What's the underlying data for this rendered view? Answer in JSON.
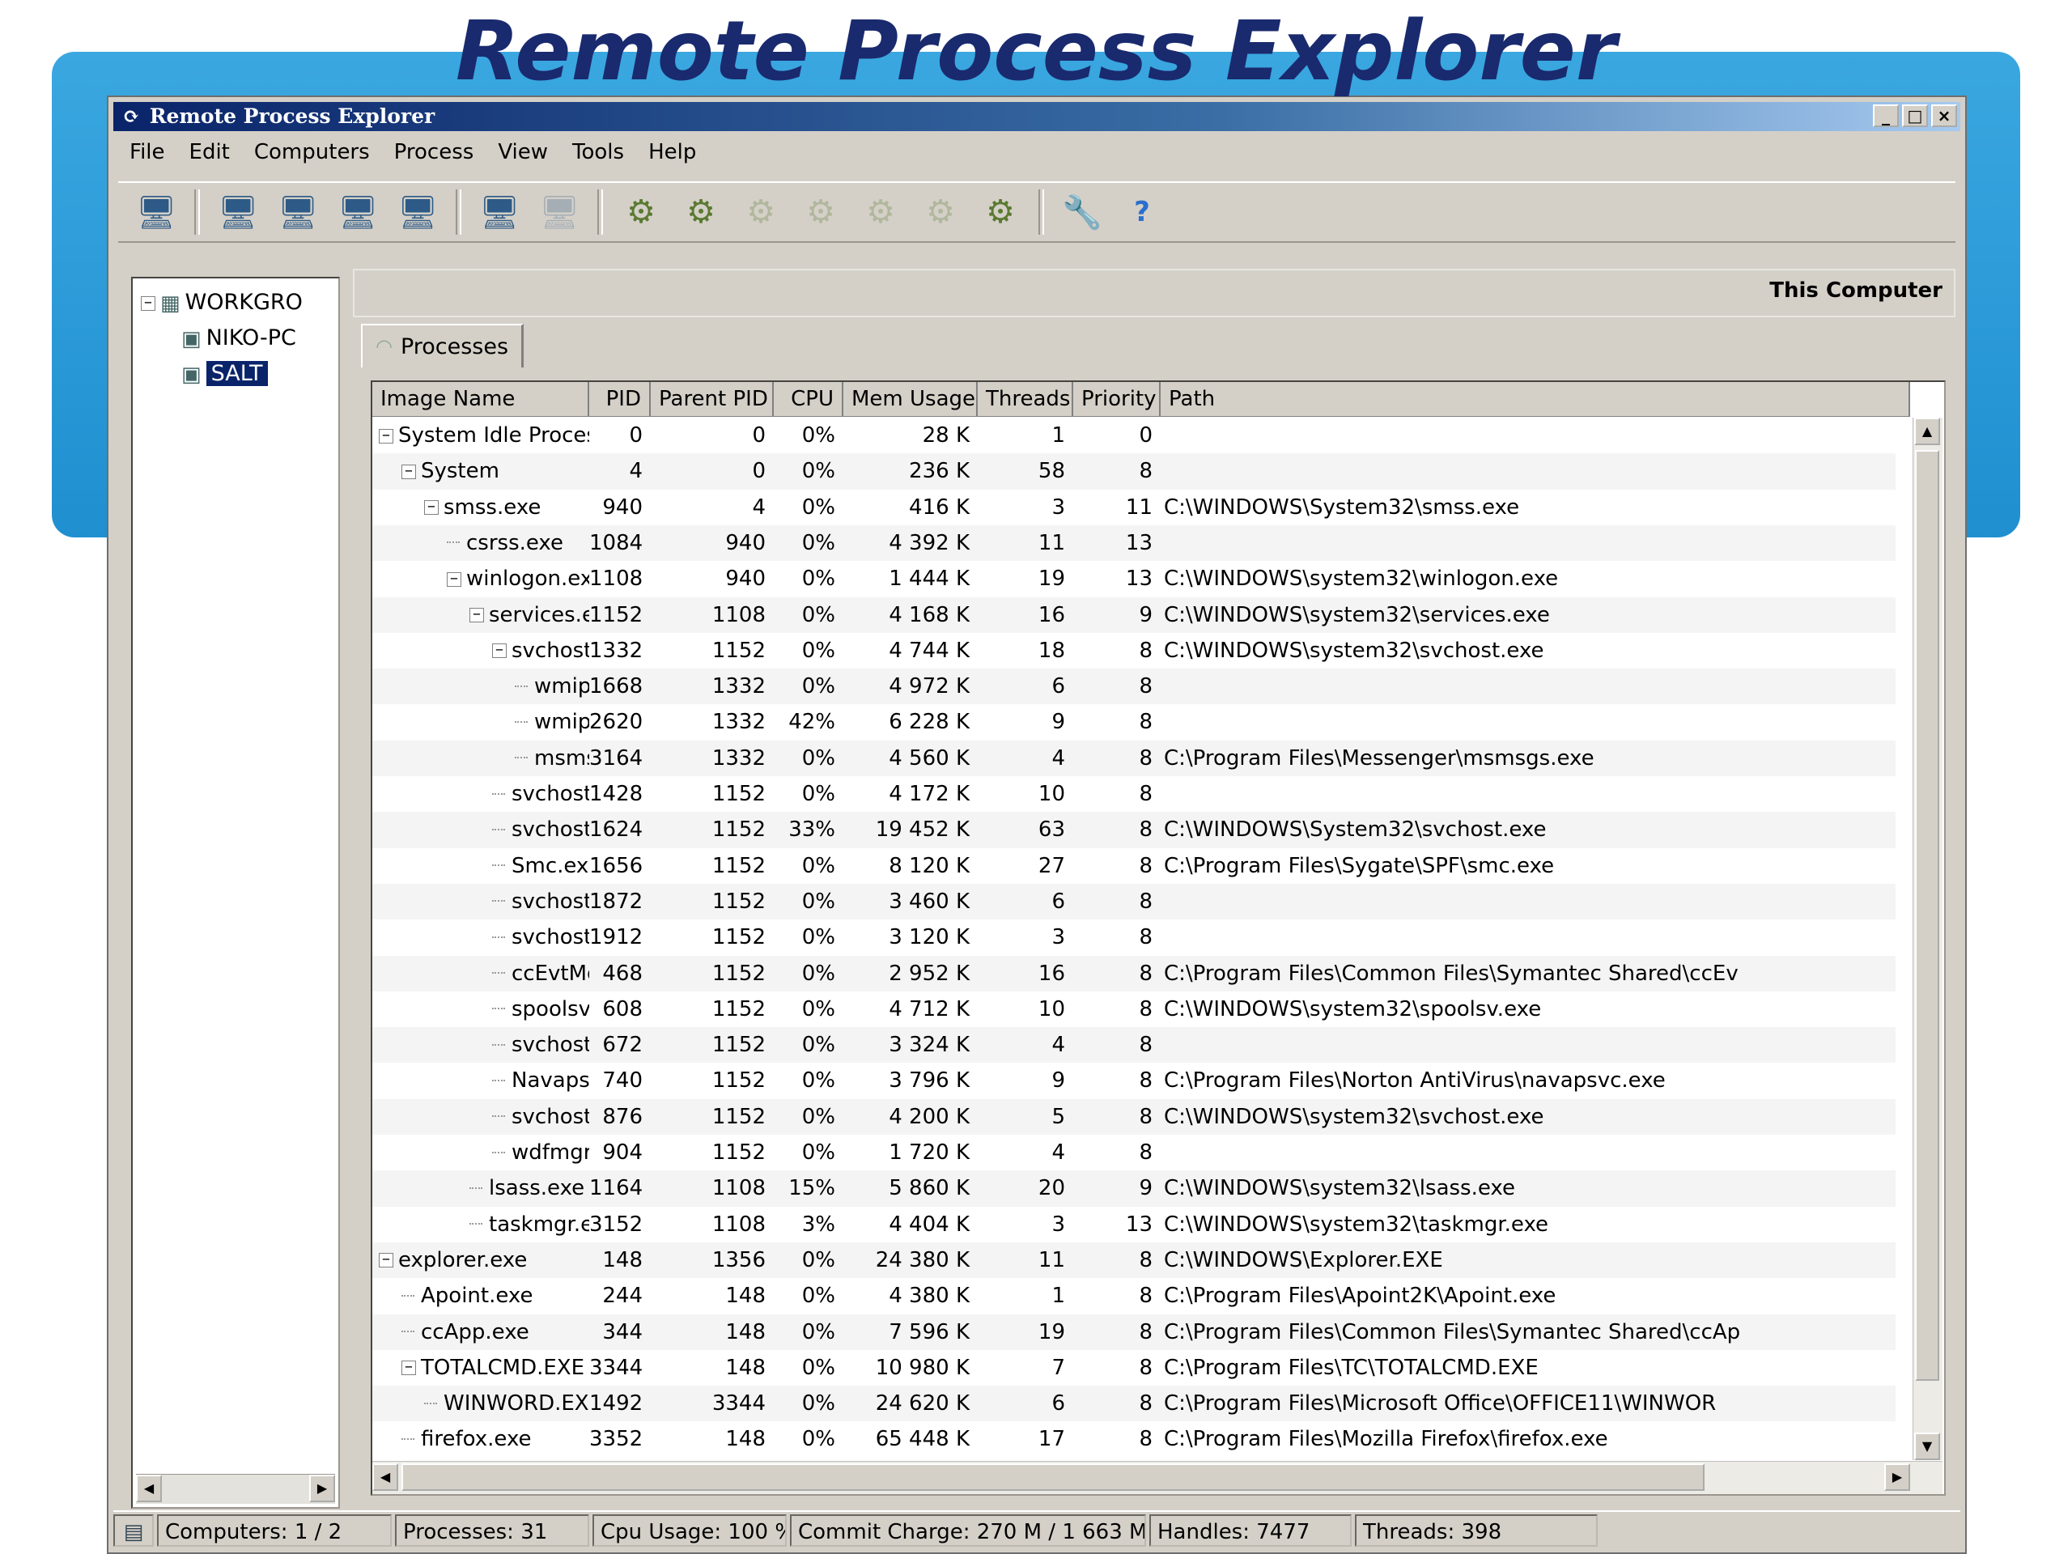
{
  "slide": {
    "title": "Remote Process Explorer"
  },
  "window": {
    "title": "Remote Process Explorer",
    "buttons": [
      "_",
      "□",
      "×"
    ]
  },
  "menu": [
    "File",
    "Edit",
    "Computers",
    "Process",
    "View",
    "Tools",
    "Help"
  ],
  "toolbar": {
    "icons": [
      {
        "name": "find-computer-icon",
        "glyph": "🖥",
        "enabled": true
      },
      {
        "name": "add-computer-icon",
        "glyph": "🖥",
        "enabled": true
      },
      {
        "name": "connect-computer-icon",
        "glyph": "🖥",
        "enabled": true
      },
      {
        "name": "remove-computer-icon",
        "glyph": "🖥",
        "enabled": true
      },
      {
        "name": "computer-properties-icon",
        "glyph": "🖥",
        "enabled": true
      },
      {
        "name": "refresh-computer-icon",
        "glyph": "🖥",
        "enabled": true
      },
      {
        "name": "disconnect-computer-icon",
        "glyph": "🖥",
        "enabled": false
      },
      {
        "name": "run-process-icon",
        "glyph": "⚙",
        "enabled": true
      },
      {
        "name": "process-settings-icon",
        "glyph": "⚙",
        "enabled": true
      },
      {
        "name": "kill-process-icon",
        "glyph": "⚙",
        "enabled": false
      },
      {
        "name": "suspend-process-icon",
        "glyph": "⚙",
        "enabled": false
      },
      {
        "name": "process-priority-icon",
        "glyph": "⚙",
        "enabled": false
      },
      {
        "name": "process-info-icon",
        "glyph": "⚙",
        "enabled": false
      },
      {
        "name": "services-icon",
        "glyph": "⚙",
        "enabled": true
      },
      {
        "name": "tools-icon",
        "glyph": "🔧",
        "enabled": true
      },
      {
        "name": "help-icon",
        "glyph": "?",
        "enabled": true
      }
    ]
  },
  "tree": {
    "root": "WORKGRO",
    "children": [
      "NIKO-PC",
      "SALT"
    ],
    "selected": "SALT"
  },
  "pane": {
    "header": "This Computer",
    "tab": "Processes"
  },
  "columns": [
    "Image Name",
    "PID",
    "Parent PID",
    "CPU",
    "Mem Usage",
    "Threads",
    "Priority",
    "Path"
  ],
  "processes": [
    {
      "name": "System Idle Process",
      "depth": 0,
      "expander": "−",
      "pid": "0",
      "ppid": "0",
      "cpu": "0%",
      "mem": "28 K",
      "threads": "1",
      "priority": "0",
      "path": ""
    },
    {
      "name": "System",
      "depth": 1,
      "expander": "−",
      "pid": "4",
      "ppid": "0",
      "cpu": "0%",
      "mem": "236 K",
      "threads": "58",
      "priority": "8",
      "path": ""
    },
    {
      "name": "smss.exe",
      "depth": 2,
      "expander": "−",
      "pid": "940",
      "ppid": "4",
      "cpu": "0%",
      "mem": "416 K",
      "threads": "3",
      "priority": "11",
      "path": "C:\\WINDOWS\\System32\\smss.exe"
    },
    {
      "name": "csrss.exe",
      "depth": 3,
      "expander": "",
      "pid": "1084",
      "ppid": "940",
      "cpu": "0%",
      "mem": "4 392 K",
      "threads": "11",
      "priority": "13",
      "path": ""
    },
    {
      "name": "winlogon.exe",
      "depth": 3,
      "expander": "−",
      "pid": "1108",
      "ppid": "940",
      "cpu": "0%",
      "mem": "1 444 K",
      "threads": "19",
      "priority": "13",
      "path": "C:\\WINDOWS\\system32\\winlogon.exe"
    },
    {
      "name": "services.exe",
      "depth": 4,
      "expander": "−",
      "pid": "1152",
      "ppid": "1108",
      "cpu": "0%",
      "mem": "4 168 K",
      "threads": "16",
      "priority": "9",
      "path": "C:\\WINDOWS\\system32\\services.exe"
    },
    {
      "name": "svchost.exe",
      "depth": 5,
      "expander": "−",
      "pid": "1332",
      "ppid": "1152",
      "cpu": "0%",
      "mem": "4 744 K",
      "threads": "18",
      "priority": "8",
      "path": "C:\\WINDOWS\\system32\\svchost.exe"
    },
    {
      "name": "wmiprvse.exe",
      "depth": 6,
      "expander": "",
      "pid": "1668",
      "ppid": "1332",
      "cpu": "0%",
      "mem": "4 972 K",
      "threads": "6",
      "priority": "8",
      "path": ""
    },
    {
      "name": "wmiprvse.exe",
      "depth": 6,
      "expander": "",
      "pid": "2620",
      "ppid": "1332",
      "cpu": "42%",
      "mem": "6 228 K",
      "threads": "9",
      "priority": "8",
      "path": ""
    },
    {
      "name": "msmsgs.exe",
      "depth": 6,
      "expander": "",
      "pid": "3164",
      "ppid": "1332",
      "cpu": "0%",
      "mem": "4 560 K",
      "threads": "4",
      "priority": "8",
      "path": "C:\\Program Files\\Messenger\\msmsgs.exe"
    },
    {
      "name": "svchost.exe",
      "depth": 5,
      "expander": "",
      "pid": "1428",
      "ppid": "1152",
      "cpu": "0%",
      "mem": "4 172 K",
      "threads": "10",
      "priority": "8",
      "path": ""
    },
    {
      "name": "svchost.exe",
      "depth": 5,
      "expander": "",
      "pid": "1624",
      "ppid": "1152",
      "cpu": "33%",
      "mem": "19 452 K",
      "threads": "63",
      "priority": "8",
      "path": "C:\\WINDOWS\\System32\\svchost.exe"
    },
    {
      "name": "Smc.exe",
      "depth": 5,
      "expander": "",
      "pid": "1656",
      "ppid": "1152",
      "cpu": "0%",
      "mem": "8 120 K",
      "threads": "27",
      "priority": "8",
      "path": "C:\\Program Files\\Sygate\\SPF\\smc.exe"
    },
    {
      "name": "svchost.exe",
      "depth": 5,
      "expander": "",
      "pid": "1872",
      "ppid": "1152",
      "cpu": "0%",
      "mem": "3 460 K",
      "threads": "6",
      "priority": "8",
      "path": ""
    },
    {
      "name": "svchost.exe",
      "depth": 5,
      "expander": "",
      "pid": "1912",
      "ppid": "1152",
      "cpu": "0%",
      "mem": "3 120 K",
      "threads": "3",
      "priority": "8",
      "path": ""
    },
    {
      "name": "ccEvtMgr.exe",
      "depth": 5,
      "expander": "",
      "pid": "468",
      "ppid": "1152",
      "cpu": "0%",
      "mem": "2 952 K",
      "threads": "16",
      "priority": "8",
      "path": "C:\\Program Files\\Common Files\\Symantec Shared\\ccEv"
    },
    {
      "name": "spoolsv.exe",
      "depth": 5,
      "expander": "",
      "pid": "608",
      "ppid": "1152",
      "cpu": "0%",
      "mem": "4 712 K",
      "threads": "10",
      "priority": "8",
      "path": "C:\\WINDOWS\\system32\\spoolsv.exe"
    },
    {
      "name": "svchost.exe",
      "depth": 5,
      "expander": "",
      "pid": "672",
      "ppid": "1152",
      "cpu": "0%",
      "mem": "3 324 K",
      "threads": "4",
      "priority": "8",
      "path": ""
    },
    {
      "name": "Navapsvc.exe",
      "depth": 5,
      "expander": "",
      "pid": "740",
      "ppid": "1152",
      "cpu": "0%",
      "mem": "3 796 K",
      "threads": "9",
      "priority": "8",
      "path": "C:\\Program Files\\Norton AntiVirus\\navapsvc.exe"
    },
    {
      "name": "svchost.exe",
      "depth": 5,
      "expander": "",
      "pid": "876",
      "ppid": "1152",
      "cpu": "0%",
      "mem": "4 200 K",
      "threads": "5",
      "priority": "8",
      "path": "C:\\WINDOWS\\system32\\svchost.exe"
    },
    {
      "name": "wdfmgr.exe",
      "depth": 5,
      "expander": "",
      "pid": "904",
      "ppid": "1152",
      "cpu": "0%",
      "mem": "1 720 K",
      "threads": "4",
      "priority": "8",
      "path": ""
    },
    {
      "name": "lsass.exe",
      "depth": 4,
      "expander": "",
      "pid": "1164",
      "ppid": "1108",
      "cpu": "15%",
      "mem": "5 860 K",
      "threads": "20",
      "priority": "9",
      "path": "C:\\WINDOWS\\system32\\lsass.exe"
    },
    {
      "name": "taskmgr.exe",
      "depth": 4,
      "expander": "",
      "pid": "3152",
      "ppid": "1108",
      "cpu": "3%",
      "mem": "4 404 K",
      "threads": "3",
      "priority": "13",
      "path": "C:\\WINDOWS\\system32\\taskmgr.exe"
    },
    {
      "name": "explorer.exe",
      "depth": 0,
      "expander": "−",
      "pid": "148",
      "ppid": "1356",
      "cpu": "0%",
      "mem": "24 380 K",
      "threads": "11",
      "priority": "8",
      "path": "C:\\WINDOWS\\Explorer.EXE"
    },
    {
      "name": "Apoint.exe",
      "depth": 1,
      "expander": "",
      "pid": "244",
      "ppid": "148",
      "cpu": "0%",
      "mem": "4 380 K",
      "threads": "1",
      "priority": "8",
      "path": "C:\\Program Files\\Apoint2K\\Apoint.exe"
    },
    {
      "name": "ccApp.exe",
      "depth": 1,
      "expander": "",
      "pid": "344",
      "ppid": "148",
      "cpu": "0%",
      "mem": "7 596 K",
      "threads": "19",
      "priority": "8",
      "path": "C:\\Program Files\\Common Files\\Symantec Shared\\ccAp"
    },
    {
      "name": "TOTALCMD.EXE",
      "depth": 1,
      "expander": "−",
      "pid": "3344",
      "ppid": "148",
      "cpu": "0%",
      "mem": "10 980 K",
      "threads": "7",
      "priority": "8",
      "path": "C:\\Program Files\\TC\\TOTALCMD.EXE"
    },
    {
      "name": "WINWORD.EXE",
      "depth": 2,
      "expander": "",
      "pid": "1492",
      "ppid": "3344",
      "cpu": "0%",
      "mem": "24 620 K",
      "threads": "6",
      "priority": "8",
      "path": "C:\\Program Files\\Microsoft Office\\OFFICE11\\WINWOR"
    },
    {
      "name": "firefox.exe",
      "depth": 1,
      "expander": "",
      "pid": "3352",
      "ppid": "148",
      "cpu": "0%",
      "mem": "65 448 K",
      "threads": "17",
      "priority": "8",
      "path": "C:\\Program Files\\Mozilla Firefox\\firefox.exe"
    }
  ],
  "status": {
    "computers": "Computers: 1 / 2",
    "processes": "Processes: 31",
    "cpu": "Cpu Usage: 100 %",
    "commit": "Commit Charge: 270 M / 1 663 M",
    "handles": "Handles: 7477",
    "threads": "Threads: 398"
  }
}
